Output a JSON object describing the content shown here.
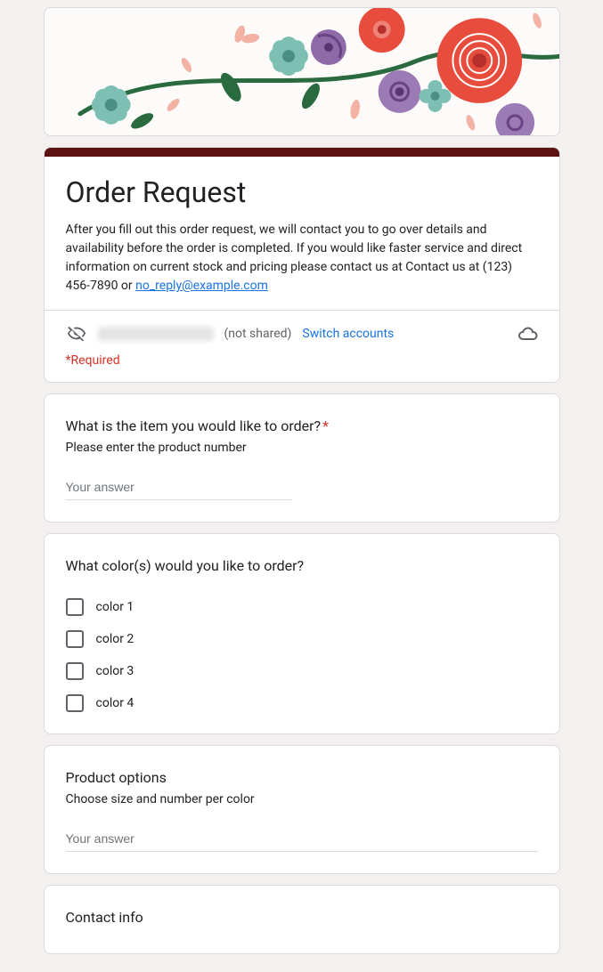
{
  "title": "Order Request",
  "description": "After you fill out this order request, we will contact you to go over details and availability before the order is completed. If you would like faster service and direct information on current stock and pricing please contact us at Contact us at (123) 456-7890 or ",
  "email_link": "no_reply@example.com",
  "meta": {
    "not_shared": "(not shared)",
    "switch": "Switch accounts"
  },
  "required_notice": "*Required",
  "q1": {
    "title": "What is the item you would like to order?",
    "help": "Please enter the product number",
    "placeholder": "Your answer"
  },
  "q2": {
    "title": "What color(s) would you like to order?",
    "options": [
      "color 1",
      "color 2",
      "color 3",
      "color 4"
    ]
  },
  "q3": {
    "title": "Product options",
    "help": "Choose size and number per color",
    "placeholder": "Your answer"
  },
  "q4": {
    "title": "Contact info"
  }
}
